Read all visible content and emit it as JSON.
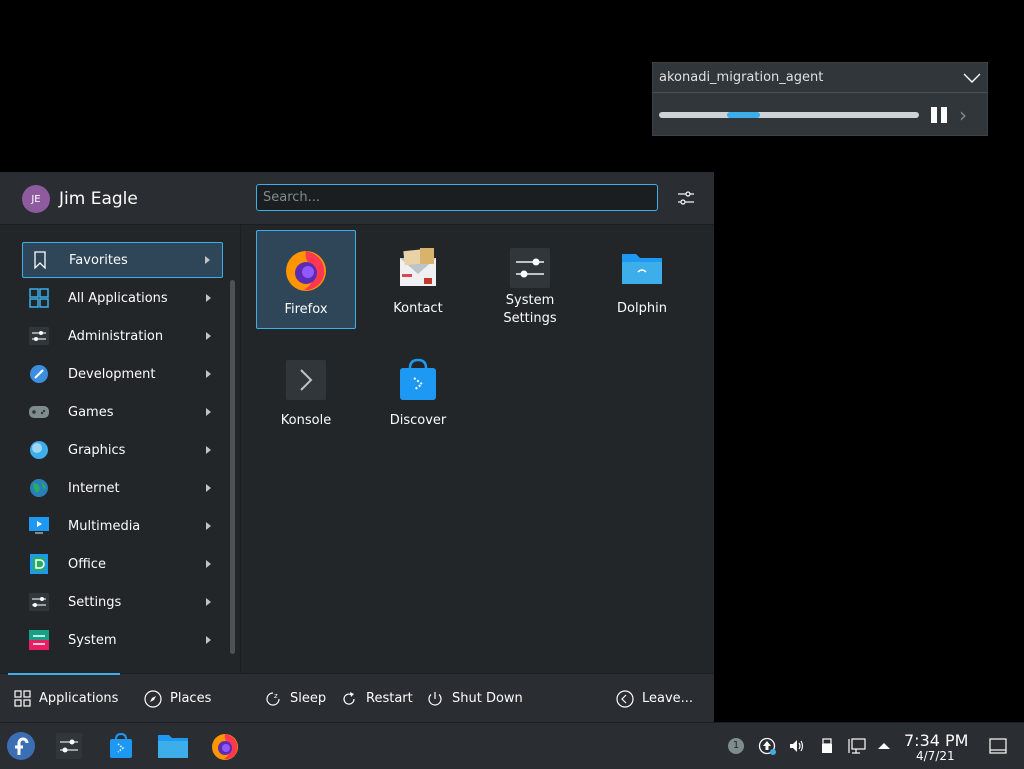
{
  "notification": {
    "title": "akonadi_migration_agent",
    "progress_fraction_start": 0.26,
    "progress_fraction_end": 0.39
  },
  "launcher": {
    "user": {
      "initials": "JE",
      "name": "Jim Eagle"
    },
    "search": {
      "placeholder": "Search...",
      "value": ""
    },
    "categories": [
      {
        "label": "Favorites",
        "icon": "bookmark-icon",
        "selected": true
      },
      {
        "label": "All Applications",
        "icon": "grid-apps-icon"
      },
      {
        "label": "Administration",
        "icon": "admin-icon"
      },
      {
        "label": "Development",
        "icon": "development-icon"
      },
      {
        "label": "Games",
        "icon": "gamepad-icon"
      },
      {
        "label": "Graphics",
        "icon": "graphics-icon"
      },
      {
        "label": "Internet",
        "icon": "globe-icon"
      },
      {
        "label": "Multimedia",
        "icon": "multimedia-icon"
      },
      {
        "label": "Office",
        "icon": "office-icon"
      },
      {
        "label": "Settings",
        "icon": "settings-sliders-icon"
      },
      {
        "label": "System",
        "icon": "system-icon"
      }
    ],
    "favorites": [
      {
        "name": "Firefox",
        "icon": "firefox-icon",
        "selected": true
      },
      {
        "name": "Kontact",
        "icon": "kontact-icon"
      },
      {
        "name": "System Settings",
        "icon": "system-settings-icon"
      },
      {
        "name": "Dolphin",
        "icon": "dolphin-folder-icon"
      },
      {
        "name": "Konsole",
        "icon": "konsole-icon"
      },
      {
        "name": "Discover",
        "icon": "discover-icon"
      }
    ],
    "footer": {
      "applications": "Applications",
      "places": "Places",
      "sleep": "Sleep",
      "restart": "Restart",
      "shutdown": "Shut Down",
      "leave": "Leave..."
    }
  },
  "taskbar": {
    "tasks": [
      "fedora-logo-icon",
      "system-settings-icon",
      "discover-icon",
      "dolphin-folder-icon",
      "firefox-icon"
    ],
    "tray": {
      "notification_count": "1"
    },
    "clock": {
      "time": "7:34 PM",
      "date": "4/7/21"
    }
  },
  "colors": {
    "accent": "#3daee9",
    "panel": "#2a2e32",
    "background": "#232629"
  }
}
